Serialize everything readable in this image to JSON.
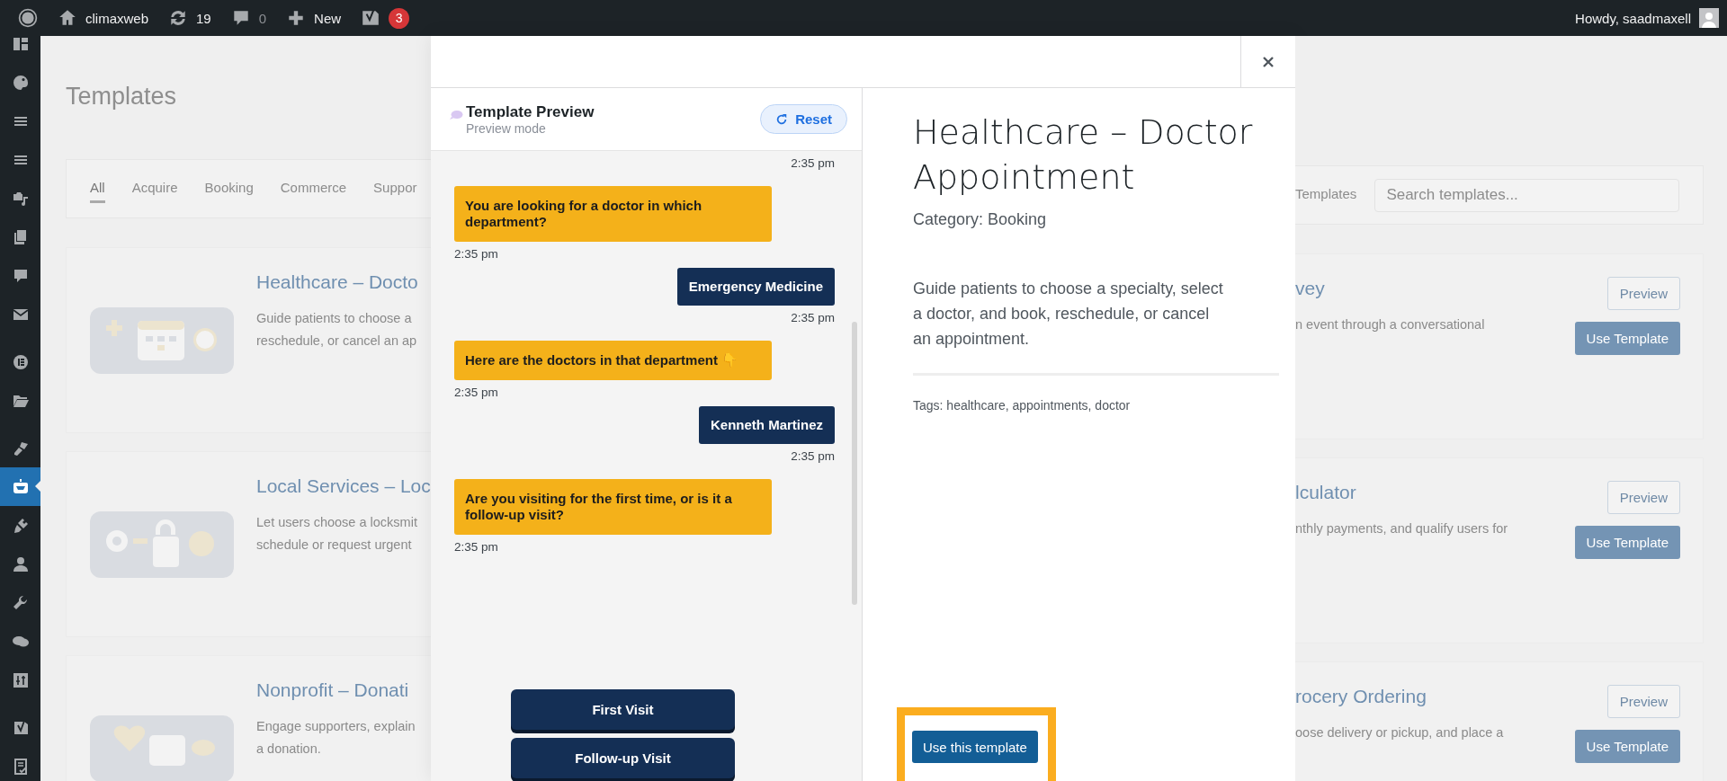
{
  "admin_bar": {
    "site_name": "climaxweb",
    "updates": "19",
    "comments": "0",
    "new_label": "New",
    "seo_badge": "3",
    "greeting": "Howdy, saadmaxell"
  },
  "sidebar": {
    "items": [
      {
        "selected": false
      },
      {
        "selected": false
      },
      {
        "selected": false
      },
      {
        "selected": false
      },
      {
        "selected": false
      },
      {
        "selected": false
      },
      {
        "selected": false
      },
      {
        "selected": false
      },
      {
        "selected": false
      },
      {
        "selected": false
      },
      {
        "selected": false
      },
      {
        "selected": true
      },
      {
        "selected": false
      },
      {
        "selected": false
      },
      {
        "selected": false
      },
      {
        "selected": false
      },
      {
        "selected": false
      },
      {
        "selected": false
      },
      {
        "selected": false
      }
    ]
  },
  "page": {
    "title": "Templates",
    "tabs": [
      {
        "label": "All",
        "selected": true
      },
      {
        "label": "Acquire",
        "selected": false
      },
      {
        "label": "Booking",
        "selected": false
      },
      {
        "label": "Commerce",
        "selected": false
      },
      {
        "label": "Suppor",
        "selected": false
      }
    ],
    "tabs_tail": "Templates",
    "search": {
      "placeholder": "Search templates..."
    },
    "left_cards": [
      {
        "title": "Healthcare – Docto",
        "description": [
          "Guide patients to choose a",
          "reschedule, or cancel an ap"
        ]
      },
      {
        "title": "Local Services – Loc",
        "description": [
          "Let users choose a locksmit",
          "schedule or request urgent"
        ]
      },
      {
        "title": "Nonprofit – Donati",
        "description": [
          "Engage supporters, explain",
          "a donation."
        ]
      }
    ],
    "right_cards": [
      {
        "title": "vey",
        "description": [
          "n event through a conversational"
        ],
        "buttons": [
          "Preview",
          "Use Template"
        ]
      },
      {
        "title": "lculator",
        "description": [
          "nthly payments, and qualify users for"
        ],
        "buttons": [
          "Preview",
          "Use Template"
        ]
      },
      {
        "title": "rocery Ordering",
        "description": [
          "oose delivery or pickup, and place a"
        ],
        "buttons": [
          "Preview",
          "Use Template"
        ]
      }
    ]
  },
  "modal": {
    "preview": {
      "title": "Template Preview",
      "subtitle": "Preview mode",
      "reset": "Reset",
      "chat": [
        {
          "kind": "time",
          "text": "2:35 pm"
        },
        {
          "kind": "bot",
          "text": "You are looking for a doctor in which department?"
        },
        {
          "kind": "time",
          "text": "2:35 pm"
        },
        {
          "kind": "user",
          "text": "Emergency Medicine"
        },
        {
          "kind": "time",
          "text": "2:35 pm"
        },
        {
          "kind": "bot",
          "text": "Here are the doctors in that department 👇"
        },
        {
          "kind": "time",
          "text": "2:35 pm"
        },
        {
          "kind": "user",
          "text": "Kenneth Martinez"
        },
        {
          "kind": "time",
          "text": "2:35 pm"
        },
        {
          "kind": "bot",
          "text": "Are you visiting for the first time, or is it a follow-up visit?"
        },
        {
          "kind": "time",
          "text": "2:35 pm"
        }
      ],
      "quick_replies": [
        "First Visit",
        "Follow-up Visit"
      ]
    },
    "details": {
      "title": "Healthcare – Doctor Appointment",
      "category": "Category: Booking",
      "description": "Guide patients to choose a specialty, select a doctor, and book, reschedule, or cancel an appointment.",
      "tags": "Tags: healthcare, appointments, doctor",
      "button": "Use this template",
      "highlighted": true
    }
  }
}
